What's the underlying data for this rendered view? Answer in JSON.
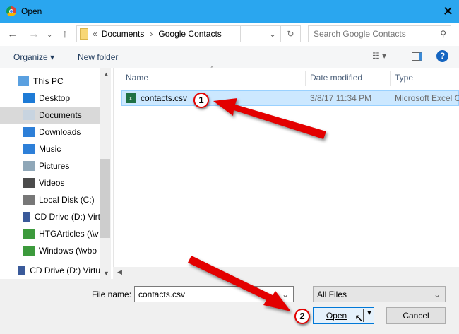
{
  "window": {
    "title": "Open",
    "close": "✕"
  },
  "address": {
    "crumbs_prefix": "«",
    "crumb1": "Documents",
    "sep": "›",
    "crumb2": "Google Contacts",
    "search_placeholder": "Search Google Contacts"
  },
  "toolbar": {
    "organize": "Organize ▾",
    "new_folder": "New folder",
    "help": "?"
  },
  "nav": {
    "items": [
      {
        "label": "This PC"
      },
      {
        "label": "Desktop"
      },
      {
        "label": "Documents"
      },
      {
        "label": "Downloads"
      },
      {
        "label": "Music"
      },
      {
        "label": "Pictures"
      },
      {
        "label": "Videos"
      },
      {
        "label": "Local Disk (C:)"
      },
      {
        "label": "CD Drive (D:) Virt"
      },
      {
        "label": "HTGArticles (\\\\v"
      },
      {
        "label": "Windows (\\\\vbo"
      },
      {
        "label": "CD Drive (D:) Virtu"
      }
    ]
  },
  "columns": {
    "name": "Name",
    "date": "Date modified",
    "type": "Type"
  },
  "files": [
    {
      "name": "contacts.csv",
      "date": "3/8/17 11:34 PM",
      "type": "Microsoft Excel C"
    }
  ],
  "bottom": {
    "file_name_label": "File name:",
    "file_name_value": "contacts.csv",
    "filter": "All Files",
    "open": "Open",
    "cancel": "Cancel"
  },
  "annotations": {
    "step1": "1",
    "step2": "2"
  },
  "colors": {
    "titlebar": "#2aa6ef",
    "selection": "#cce8ff",
    "arrow": "#e30000"
  }
}
